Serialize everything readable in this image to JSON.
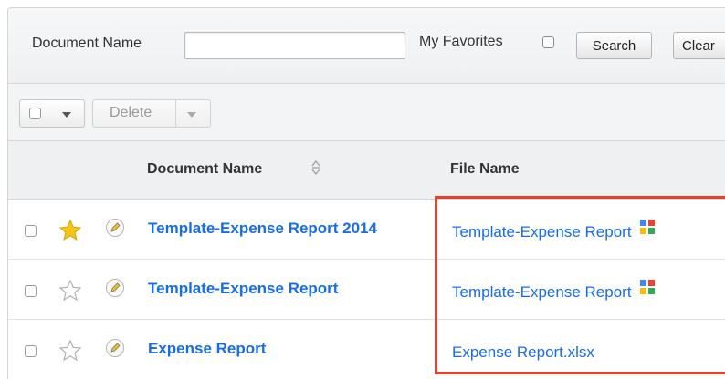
{
  "search": {
    "doc_name_label": "Document Name",
    "doc_name_value": "",
    "doc_name_placeholder": "",
    "favorites_label": "My Favorites",
    "search_button": "Search",
    "clear_button": "Clear"
  },
  "actions": {
    "delete_label": "Delete"
  },
  "table": {
    "columns": [
      "Document Name",
      "File Name"
    ],
    "rows": [
      {
        "doc_name": "Template-Expense Report 2014",
        "file_name": "Template-Expense Report",
        "favorite": true,
        "drive_icon": true
      },
      {
        "doc_name": "Template-Expense Report",
        "file_name": "Template-Expense Report",
        "favorite": false,
        "drive_icon": true
      },
      {
        "doc_name": "Expense Report",
        "file_name": "Expense Report.xlsx",
        "favorite": false,
        "drive_icon": false
      }
    ]
  },
  "colors": {
    "link": "#176de5",
    "highlight": "#e8412b",
    "star_active": "#f5c518"
  }
}
